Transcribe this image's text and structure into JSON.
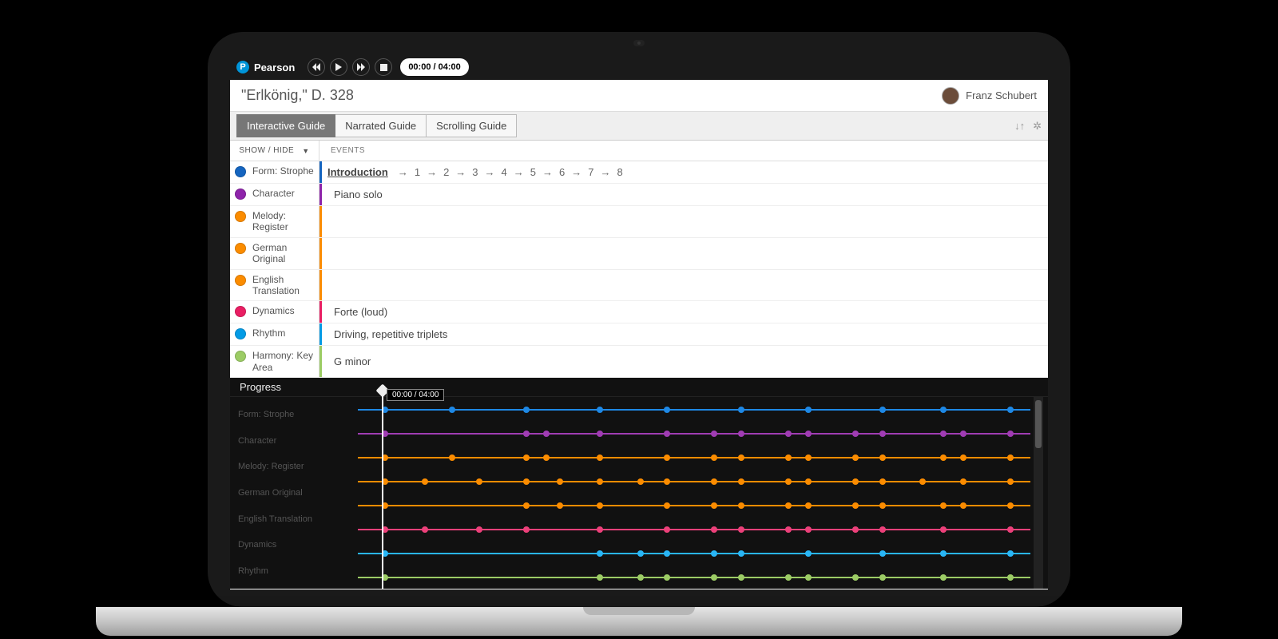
{
  "brand": "Pearson",
  "player": {
    "time_pill": "00:00 / 04:00"
  },
  "piece": {
    "title": "\"Erlkönig,\" D. 328",
    "composer": "Franz Schubert"
  },
  "tabs": [
    {
      "label": "Interactive Guide",
      "active": true
    },
    {
      "label": "Narrated Guide",
      "active": false
    },
    {
      "label": "Scrolling Guide",
      "active": false
    }
  ],
  "headers": {
    "showhide": "SHOW / HIDE",
    "events": "EVENTS"
  },
  "rows": [
    {
      "id": "form",
      "label": "Form: Strophe",
      "color": "#1565c0",
      "accent": "#1565c0",
      "value_intro": true
    },
    {
      "id": "character",
      "label": "Character",
      "color": "#8e24aa",
      "accent": "#8e24aa",
      "value": "Piano solo"
    },
    {
      "id": "melody",
      "label": "Melody: Register",
      "color": "#fb8c00",
      "accent": "#fb8c00",
      "value": ""
    },
    {
      "id": "german",
      "label": "German Original",
      "color": "#fb8c00",
      "accent": "#fb8c00",
      "value": ""
    },
    {
      "id": "english",
      "label": "English Translation",
      "color": "#fb8c00",
      "accent": "#fb8c00",
      "value": ""
    },
    {
      "id": "dynamics",
      "label": "Dynamics",
      "color": "#e91e63",
      "accent": "#e91e63",
      "value": "Forte (loud)"
    },
    {
      "id": "rhythm",
      "label": "Rhythm",
      "color": "#039be5",
      "accent": "#039be5",
      "value": "Driving, repetitive triplets"
    },
    {
      "id": "harmony",
      "label": "Harmony: Key Area",
      "color": "#9ccc65",
      "accent": "#9ccc65",
      "value": "G minor"
    }
  ],
  "intro": {
    "word": "Introduction",
    "steps": [
      "1",
      "2",
      "3",
      "4",
      "5",
      "6",
      "7",
      "8"
    ]
  },
  "progress": {
    "title": "Progress",
    "time_badge": "00:00 / 04:00",
    "side_labels": [
      "Form: Strophe",
      "Character",
      "Melody: Register",
      "German Original",
      "English Translation",
      "Dynamics",
      "Rhythm"
    ],
    "tracks": [
      {
        "color": "#1e88e5",
        "points": [
          4,
          14,
          25,
          36,
          46,
          57,
          67,
          78,
          87,
          97
        ]
      },
      {
        "color": "#a03cb3",
        "points": [
          4,
          25,
          28,
          36,
          46,
          53,
          57,
          64,
          67,
          74,
          78,
          87,
          90,
          97
        ]
      },
      {
        "color": "#fb8c00",
        "points": [
          4,
          14,
          25,
          28,
          36,
          46,
          53,
          57,
          64,
          67,
          74,
          78,
          87,
          90,
          97
        ]
      },
      {
        "color": "#fb8c00",
        "points": [
          4,
          10,
          18,
          25,
          30,
          36,
          42,
          46,
          53,
          57,
          64,
          67,
          74,
          78,
          84,
          90,
          97
        ]
      },
      {
        "color": "#fb8c00",
        "points": [
          4,
          25,
          30,
          36,
          46,
          53,
          57,
          64,
          67,
          74,
          78,
          87,
          90,
          97
        ]
      },
      {
        "color": "#ec407a",
        "points": [
          4,
          10,
          18,
          25,
          36,
          46,
          53,
          57,
          64,
          67,
          74,
          78,
          87,
          97
        ]
      },
      {
        "color": "#29b6f6",
        "points": [
          4,
          36,
          42,
          46,
          53,
          57,
          67,
          78,
          87,
          97
        ]
      },
      {
        "color": "#9ccc65",
        "points": [
          4,
          36,
          42,
          46,
          53,
          57,
          64,
          67,
          74,
          78,
          87,
          97
        ]
      }
    ]
  }
}
